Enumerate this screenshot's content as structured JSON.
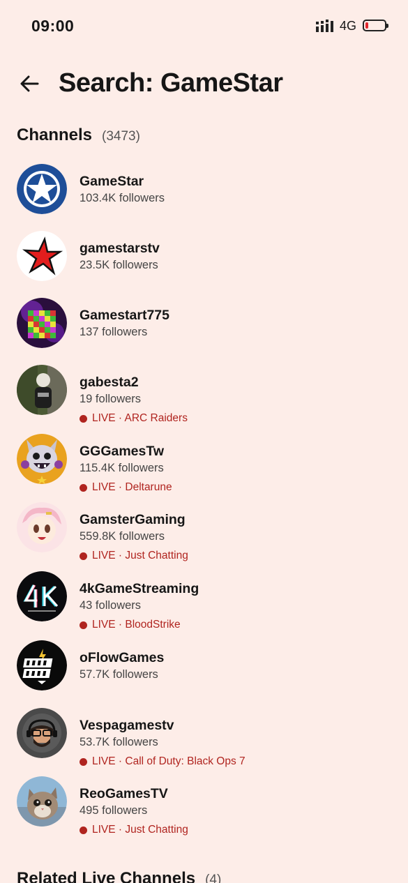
{
  "status_bar": {
    "time": "09:00",
    "network": "4G",
    "battery_level": 0.15
  },
  "header": {
    "title": "Search: GameStar"
  },
  "channels_section": {
    "title": "Channels",
    "count": "(3473)"
  },
  "channels": [
    {
      "name": "GameStar",
      "followers": "103.4K followers",
      "live": "",
      "avatar_icon": "star-badge-icon"
    },
    {
      "name": "gamestarstv",
      "followers": "23.5K followers",
      "live": "",
      "avatar_icon": "red-star-icon"
    },
    {
      "name": "Gamestart775",
      "followers": "137 followers",
      "live": "",
      "avatar_icon": "pixel-cube-icon"
    },
    {
      "name": "gabesta2",
      "followers": "19 followers",
      "live": "LIVE · ARC Raiders",
      "avatar_icon": "person-photo"
    },
    {
      "name": "GGGamesTw",
      "followers": "115.4K followers",
      "live": "LIVE · Deltarune",
      "avatar_icon": "cat-mascot-icon"
    },
    {
      "name": "GamsterGaming",
      "followers": "559.8K followers",
      "live": "LIVE · Just Chatting",
      "avatar_icon": "anime-girl-icon"
    },
    {
      "name": "4kGameStreaming",
      "followers": "43 followers",
      "live": "LIVE · BloodStrike",
      "avatar_icon": "4k-logo-icon"
    },
    {
      "name": "oFlowGames",
      "followers": "57.7K followers",
      "live": "",
      "avatar_icon": "flow-games-logo-icon"
    },
    {
      "name": "Vespagamestv",
      "followers": "53.7K followers",
      "live": "LIVE · Call of Duty: Black Ops 7",
      "avatar_icon": "bearded-gamer-icon"
    },
    {
      "name": "ReoGamesTV",
      "followers": "495 followers",
      "live": "LIVE · Just Chatting",
      "avatar_icon": "kitten-photo"
    }
  ],
  "related_section": {
    "title": "Related Live Channels",
    "count": "(4)"
  },
  "colors": {
    "background": "#FDEDE8",
    "live": "#B0241F",
    "text": "#161616"
  }
}
